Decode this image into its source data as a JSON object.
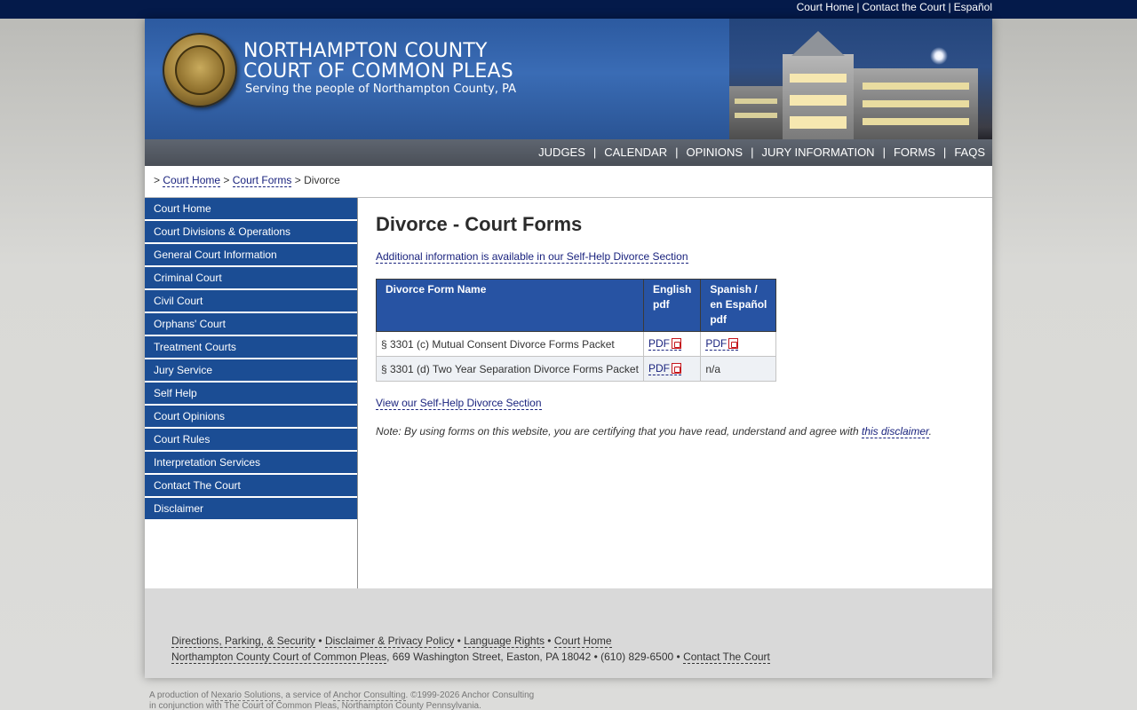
{
  "top_links": [
    "Court Home",
    "Contact the Court",
    "Español"
  ],
  "header": {
    "title_line1": "NORTHAMPTON COUNTY",
    "title_line2": "COURT OF COMMON PLEAS",
    "tagline": "Serving the people of Northampton County, PA"
  },
  "nav": [
    "JUDGES",
    "CALENDAR",
    "OPINIONS",
    "JURY INFORMATION",
    "FORMS",
    "FAQS"
  ],
  "breadcrumb": {
    "prefix": ">",
    "items": [
      "Court Home",
      "Court Forms"
    ],
    "sep": ">",
    "current": "Divorce"
  },
  "sidebar": [
    "Court Home",
    "Court Divisions & Operations",
    "General Court Information",
    "Criminal Court",
    "Civil Court",
    "Orphans' Court",
    "Treatment Courts",
    "Jury Service",
    "Self Help",
    "Court Opinions",
    "Court Rules",
    "Interpretation Services",
    "Contact The Court",
    "Disclaimer"
  ],
  "main": {
    "title": "Divorce - Court Forms",
    "additional_link": "Additional information is available in our Self-Help Divorce Section",
    "table": {
      "headers": [
        "Divorce Form Name",
        "English pdf",
        "Spanish / en Español pdf"
      ],
      "rows": [
        {
          "name": "§ 3301 (c) Mutual Consent Divorce Forms Packet",
          "english": "PDF",
          "spanish": "PDF"
        },
        {
          "name": "§ 3301 (d) Two Year Separation Divorce Forms Packet",
          "english": "PDF",
          "spanish": "n/a"
        }
      ]
    },
    "view_link": "View our Self-Help Divorce Section",
    "note_text": "Note: By using forms on this website, you are certifying that you have read, understand and agree with ",
    "note_link": "this disclaimer",
    "note_end": "."
  },
  "footer": {
    "links": [
      "Directions, Parking, & Security",
      "Disclaimer & Privacy Policy",
      "Language Rights",
      "Court Home"
    ],
    "bullet": "•",
    "org_link": "Northampton County Court of Common Pleas",
    "address": ", 669 Washington Street, Easton, PA 18042 • (610) 829-6500 • ",
    "contact_link": "Contact The Court"
  },
  "production": {
    "prefix": "A production of ",
    "nexario": "Nexario Solutions",
    "middle": ", a service of ",
    "anchor": "Anchor Consulting",
    "suffix": ". ©1999-2026 Anchor Consulting",
    "line2": "in conjunction with The Court of Common Pleas, Northampton County Pennsylvania."
  },
  "colors": {
    "top_bar": "#041a4a",
    "header_blue": "#2c5aa0",
    "sidebar_blue": "#1b4d94",
    "table_header": "#2753a3",
    "link": "#1a237e"
  }
}
